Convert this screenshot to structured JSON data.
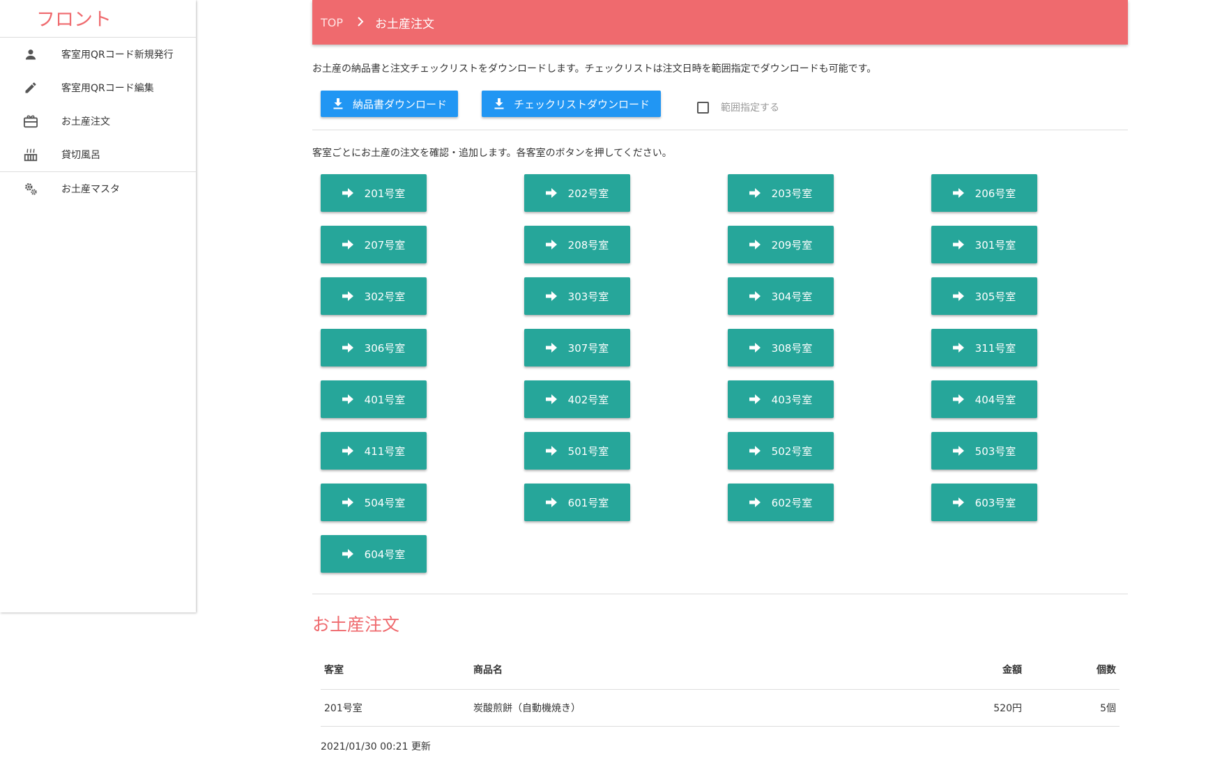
{
  "sidebar": {
    "brand": "フロント",
    "items": [
      {
        "label": "客室用QRコード新規発行",
        "icon": "person-icon"
      },
      {
        "label": "客室用QRコード編集",
        "icon": "pencil-icon"
      },
      {
        "label": "お土産注文",
        "icon": "gift-icon"
      },
      {
        "label": "貸切風呂",
        "icon": "hot-tub-icon"
      },
      {
        "label": "お土産マスタ",
        "icon": "gears-icon"
      }
    ]
  },
  "breadcrumb": {
    "top": "TOP",
    "current": "お土産注文"
  },
  "main": {
    "description": "お土産の納品書と注文チェックリストをダウンロードします。チェックリストは注文日時を範囲指定でダウンロードも可能です。",
    "download_invoice_label": "納品書ダウンロード",
    "download_checklist_label": "チェックリストダウンロード",
    "range_checkbox_label": "範囲指定する",
    "rooms_description": "客室ごとにお土産の注文を確認・追加します。各客室のボタンを押してください。",
    "rooms": [
      "201号室",
      "202号室",
      "203号室",
      "206号室",
      "207号室",
      "208号室",
      "209号室",
      "301号室",
      "302号室",
      "303号室",
      "304号室",
      "305号室",
      "306号室",
      "307号室",
      "308号室",
      "311号室",
      "401号室",
      "402号室",
      "403号室",
      "404号室",
      "411号室",
      "501号室",
      "502号室",
      "503号室",
      "504号室",
      "601号室",
      "602号室",
      "603号室",
      "604号室"
    ]
  },
  "orders": {
    "title": "お土産注文",
    "columns": {
      "room": "客室",
      "product": "商品名",
      "price": "金額",
      "qty": "個数"
    },
    "rows": [
      {
        "room": "201号室",
        "product": "炭酸煎餅（自動機焼き）",
        "price": "520円",
        "qty": "5個"
      }
    ],
    "updated": "2021/01/30 00:21 更新"
  },
  "colors": {
    "accent": "#ef6a6e",
    "blue": "#2196f3",
    "teal": "#26a69a"
  }
}
